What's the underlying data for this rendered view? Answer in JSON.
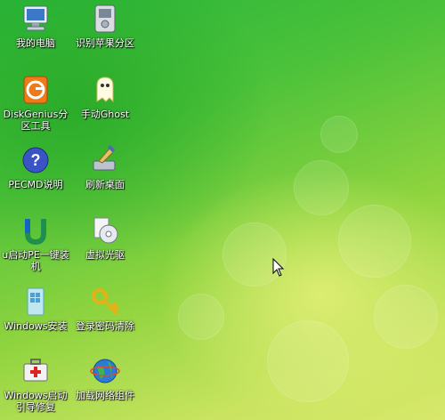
{
  "desktop": {
    "icons": [
      {
        "label": "我的电脑",
        "icon": "computer-icon"
      },
      {
        "label": "识别苹果分区",
        "icon": "drive-icon"
      },
      {
        "label": "DiskGenius分区工具",
        "icon": "diskgenius-icon"
      },
      {
        "label": "手动Ghost",
        "icon": "ghost-icon"
      },
      {
        "label": "PECMD说明",
        "icon": "help-icon"
      },
      {
        "label": "刷新桌面",
        "icon": "refresh-desktop-icon"
      },
      {
        "label": "u启动PE一键装机",
        "icon": "u-install-icon"
      },
      {
        "label": "虚拟光驱",
        "icon": "virtual-drive-icon"
      },
      {
        "label": "Windows安装",
        "icon": "windows-install-icon"
      },
      {
        "label": "登录密码清除",
        "icon": "key-icon"
      },
      {
        "label": "Windows启动引导修复",
        "icon": "toolbox-icon"
      },
      {
        "label": "加载网络组件",
        "icon": "network-globe-icon"
      }
    ]
  },
  "colors": {
    "wallpaper_top": "#28b43a",
    "wallpaper_bottom": "#d8e86a",
    "label_text": "#ffffff"
  }
}
